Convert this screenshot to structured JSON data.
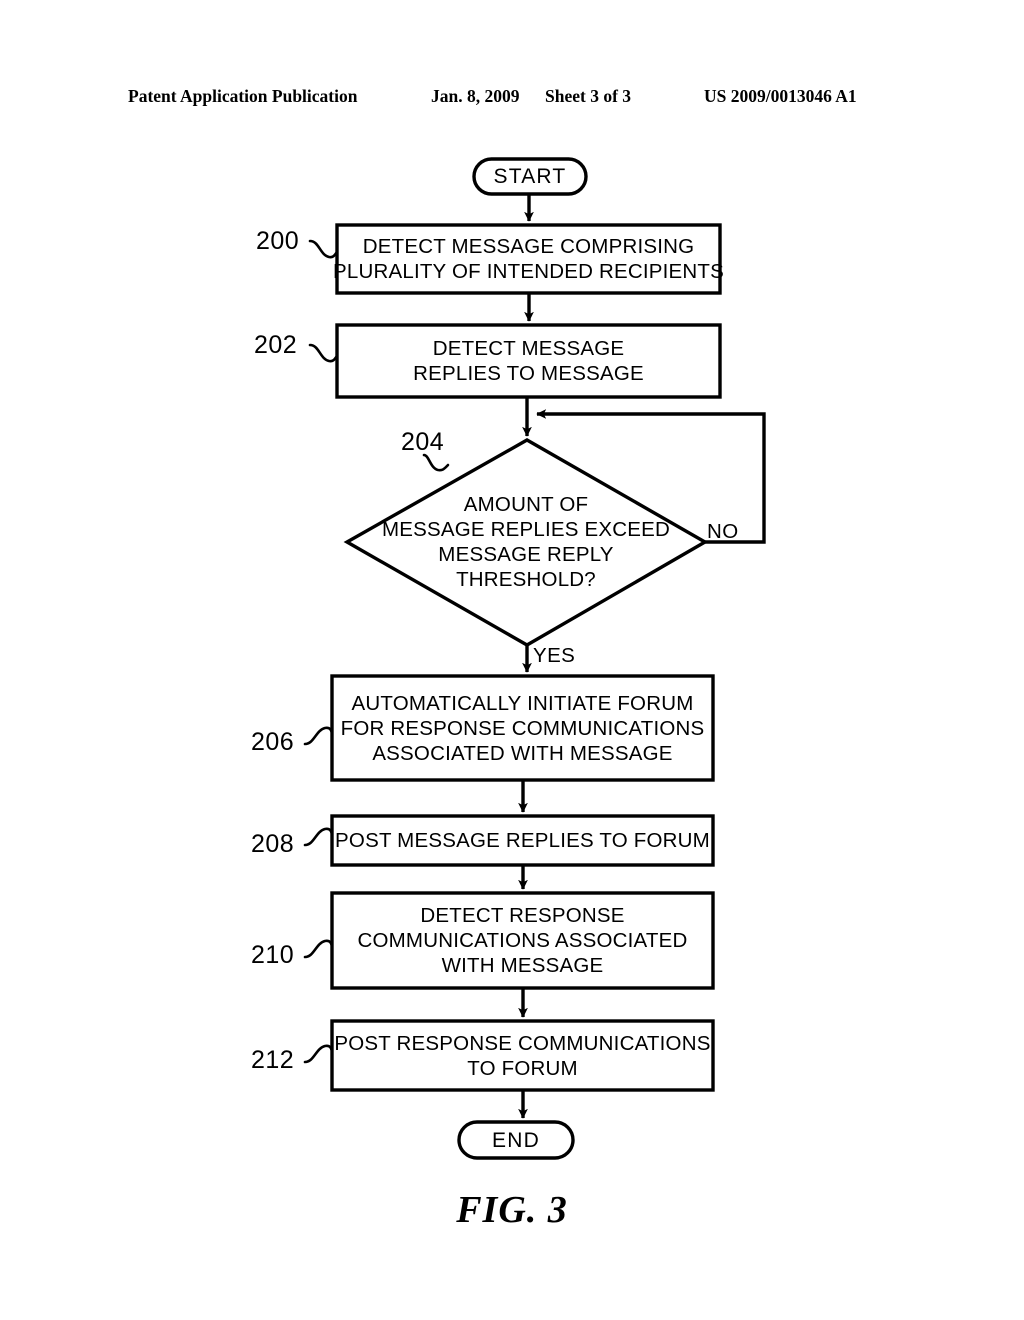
{
  "header": {
    "publication": "Patent Application Publication",
    "date": "Jan. 8, 2009",
    "sheet": "Sheet 3 of 3",
    "patent_number": "US 2009/0013046 A1"
  },
  "figure": {
    "caption": "FIG. 3",
    "ink_color": "#000000",
    "background_color": "#ffffff"
  },
  "flowchart": {
    "start": {
      "label": "START"
    },
    "end": {
      "label": "END"
    },
    "branches": {
      "no": "NO",
      "yes": "YES"
    },
    "steps": [
      {
        "ref": "200",
        "shape": "process",
        "lines": [
          "DETECT MESSAGE COMPRISING",
          "PLURALITY OF INTENDED RECIPIENTS"
        ]
      },
      {
        "ref": "202",
        "shape": "process",
        "lines": [
          "DETECT MESSAGE",
          "REPLIES TO MESSAGE"
        ]
      },
      {
        "ref": "204",
        "shape": "decision",
        "lines": [
          "AMOUNT OF",
          "MESSAGE REPLIES EXCEED",
          "MESSAGE REPLY",
          "THRESHOLD?"
        ]
      },
      {
        "ref": "206",
        "shape": "process",
        "lines": [
          "AUTOMATICALLY INITIATE FORUM",
          "FOR RESPONSE COMMUNICATIONS",
          "ASSOCIATED WITH MESSAGE"
        ]
      },
      {
        "ref": "208",
        "shape": "process",
        "lines": [
          "POST MESSAGE REPLIES TO FORUM"
        ]
      },
      {
        "ref": "210",
        "shape": "process",
        "lines": [
          "DETECT RESPONSE",
          "COMMUNICATIONS ASSOCIATED",
          "WITH MESSAGE"
        ]
      },
      {
        "ref": "212",
        "shape": "process",
        "lines": [
          "POST RESPONSE COMMUNICATIONS",
          "TO FORUM"
        ]
      }
    ]
  }
}
